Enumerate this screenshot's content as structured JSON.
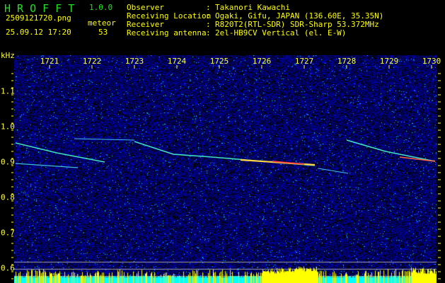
{
  "app": {
    "title": "H R O F F T",
    "version": "1.0.0"
  },
  "file": {
    "name": "2509121720.png",
    "datetime": "25.09.12 17:20"
  },
  "meteor": {
    "label": "meteor",
    "count": "53"
  },
  "info": [
    {
      "label": "Observer",
      "value": "Takanori Kawachi"
    },
    {
      "label": "Receiving Location",
      "value": "Ogaki, Gifu, JAPAN (136.60E, 35.35N)"
    },
    {
      "label": "Receiver",
      "value": "R820T2(RTL-SDR) SDR-Sharp 53.372MHz"
    },
    {
      "label": "Receiving antenna",
      "value": "2el-HB9CV Vertical (el. E-W)"
    }
  ],
  "axis": {
    "unit": "kHz",
    "x_ticks": [
      "1721",
      "1722",
      "1723",
      "1724",
      "1725",
      "1726",
      "1727",
      "1728",
      "1729",
      "1730"
    ],
    "y_ticks": [
      "1.1",
      "1.0",
      "0.9",
      "0.8",
      "0.7",
      "0.6"
    ]
  },
  "colors": {
    "text": "#ffff00",
    "title": "#20e020",
    "noise": "#0000c0",
    "level": "#ffff00",
    "floor": "#00ffff"
  }
}
